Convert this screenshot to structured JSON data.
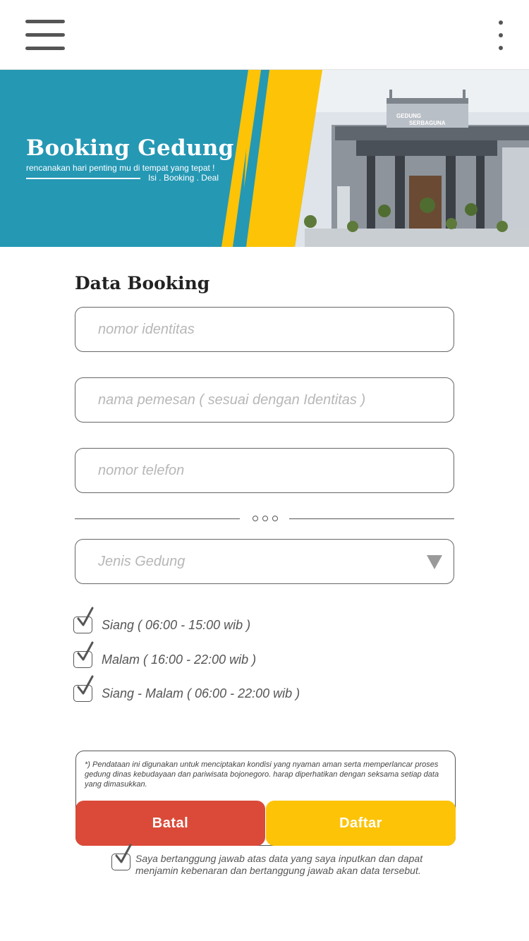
{
  "header": {
    "menu_icon": "hamburger-menu-icon",
    "more_icon": "more-vertical-icon"
  },
  "banner": {
    "title": "Booking Gedung",
    "subtitle": "rencanakan hari penting mu di tempat yang tepat !",
    "tagline": "Isi . Booking . Deal",
    "building_sign": "GEDUNG SERBAGUNA",
    "colors": {
      "teal": "#2598b4",
      "yellow": "#fdc307"
    }
  },
  "form": {
    "title": "Data Booking",
    "fields": [
      {
        "placeholder": "nomor identitas",
        "value": ""
      },
      {
        "placeholder": "nama pemesan ( sesuai dengan Identitas )",
        "value": ""
      },
      {
        "placeholder": "nomor telefon",
        "value": ""
      }
    ],
    "building_type": {
      "value": "Jenis Gedung",
      "icon": "dropdown-triangle-icon"
    },
    "time_options": [
      {
        "label": "Siang ( 06:00 - 15:00 wib )",
        "checked": true
      },
      {
        "label": "Malam ( 16:00 - 22:00 wib )",
        "checked": true
      },
      {
        "label": "Siang - Malam ( 06:00 - 22:00 wib )",
        "checked": true
      }
    ]
  },
  "notice": {
    "text": "*) Pendataan ini digunakan untuk menciptakan kondisi yang nyaman aman serta memperlancar proses gedung dinas kebudayaan dan pariwisata bojonegoro. harap diperhatikan dengan seksama setiap data yang dimasukkan."
  },
  "actions": {
    "cancel_label": "Batal",
    "submit_label": "Daftar",
    "cancel_color": "#db4a39",
    "submit_color": "#fdc307"
  },
  "agreement": {
    "text": "Saya bertanggung jawab atas data yang saya inputkan dan dapat menjamin kebenaran dan bertanggung jawab akan data tersebut.",
    "checked": true
  }
}
